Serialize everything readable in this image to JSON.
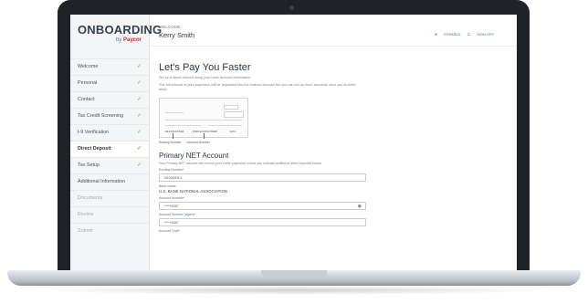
{
  "brand": {
    "logo_main": "ONBOARDING",
    "logo_by": "by",
    "logo_company": "Paycor"
  },
  "header": {
    "welcome": "WELCOME,",
    "user_name": "Kerry Smith",
    "language_link": "ESPAÑOL",
    "signoff_link": "SIGN OFF"
  },
  "sidebar": {
    "items": [
      {
        "label": "Welcome",
        "complete": true
      },
      {
        "label": "Personal",
        "complete": true
      },
      {
        "label": "Contact",
        "complete": true
      },
      {
        "label": "Tax Credit Screening",
        "complete": true
      },
      {
        "label": "I-9 Verification",
        "complete": true
      },
      {
        "label": "Direct Deposit",
        "complete": true,
        "active": true
      },
      {
        "label": "Tax Setup",
        "complete": true
      },
      {
        "label": "Additional Information",
        "complete": false
      },
      {
        "label": "Documents",
        "complete": false,
        "disabled": true
      },
      {
        "label": "Review",
        "complete": false,
        "disabled": true
      },
      {
        "label": "Submit",
        "complete": false,
        "disabled": true
      }
    ],
    "check_glyph": "✓"
  },
  "main": {
    "title": "Let's Pay You Faster",
    "subtitle": "Set up a direct deposit using your bank account information.",
    "description": "The full amount of your paycheck will be deposited into the entered account but you can set up more accounts once you've been hired.",
    "check_image": {
      "routing_label": "Routing Number",
      "account_label": "Account Number",
      "routing_digits": "⑆123456789⑆",
      "account_digits": "⑈0001234567890⑈",
      "check_number": "1234"
    },
    "section_title": "Primary NET Account",
    "section_desc": "Your Primary NET account will receive your entire paycheck unless you indicate additional direct deposits below.",
    "fields": {
      "routing_label": "Routing Number*",
      "routing_value": "042000013",
      "bank_label": "Bank Name",
      "bank_value": "U.S. BANK NATIONAL ASSOCIATION",
      "account_label": "Account Number*",
      "account_value": "*****4567",
      "account_again_label": "Account Number (again)*",
      "account_again_value": "*****4567",
      "account_type_label": "Account Type*"
    }
  },
  "colors": {
    "accent": "#7cb342",
    "brand_red": "#d4242b",
    "link": "#3d6fa6"
  }
}
